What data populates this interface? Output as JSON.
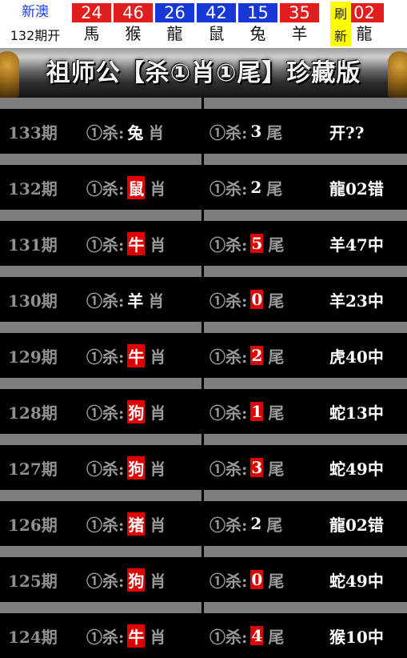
{
  "header": {
    "label_top": "新澳",
    "label_bottom": "132期开",
    "balls": [
      {
        "number": "24",
        "zodiac": "馬",
        "color": "#e11d1d"
      },
      {
        "number": "46",
        "zodiac": "猴",
        "color": "#e11d1d"
      },
      {
        "number": "26",
        "zodiac": "龍",
        "color": "#1838d6"
      },
      {
        "number": "42",
        "zodiac": "鼠",
        "color": "#1838d6"
      },
      {
        "number": "15",
        "zodiac": "兔",
        "color": "#1838d6"
      },
      {
        "number": "35",
        "zodiac": "羊",
        "color": "#e11d1d"
      },
      {
        "number": "02",
        "zodiac": "龍",
        "color": "#e11d1d"
      }
    ],
    "refresh_top": "刷",
    "refresh_bottom": "新"
  },
  "banner": {
    "title": "祖师公【杀①肖①尾】珍藏版"
  },
  "table": {
    "kill_label": "①杀:",
    "zodiac_suffix": "肖",
    "tail_suffix": "尾",
    "rows": [
      {
        "period": "133期",
        "zodiac": "兔",
        "zodiac_hit": false,
        "tail": "3",
        "tail_hit": false,
        "result": "开??"
      },
      {
        "period": "132期",
        "zodiac": "鼠",
        "zodiac_hit": true,
        "tail": "2",
        "tail_hit": false,
        "result": "龍02错"
      },
      {
        "period": "131期",
        "zodiac": "牛",
        "zodiac_hit": true,
        "tail": "5",
        "tail_hit": true,
        "result": "羊47中"
      },
      {
        "period": "130期",
        "zodiac": "羊",
        "zodiac_hit": false,
        "tail": "0",
        "tail_hit": true,
        "result": "羊23中"
      },
      {
        "period": "129期",
        "zodiac": "牛",
        "zodiac_hit": true,
        "tail": "2",
        "tail_hit": true,
        "result": "虎40中"
      },
      {
        "period": "128期",
        "zodiac": "狗",
        "zodiac_hit": true,
        "tail": "1",
        "tail_hit": true,
        "result": "蛇13中"
      },
      {
        "period": "127期",
        "zodiac": "狗",
        "zodiac_hit": true,
        "tail": "3",
        "tail_hit": true,
        "result": "蛇49中"
      },
      {
        "period": "126期",
        "zodiac": "猪",
        "zodiac_hit": true,
        "tail": "2",
        "tail_hit": false,
        "result": "龍02错"
      },
      {
        "period": "125期",
        "zodiac": "狗",
        "zodiac_hit": true,
        "tail": "0",
        "tail_hit": true,
        "result": "蛇49中"
      },
      {
        "period": "124期",
        "zodiac": "牛",
        "zodiac_hit": true,
        "tail": "4",
        "tail_hit": true,
        "result": "猴10中"
      }
    ]
  }
}
